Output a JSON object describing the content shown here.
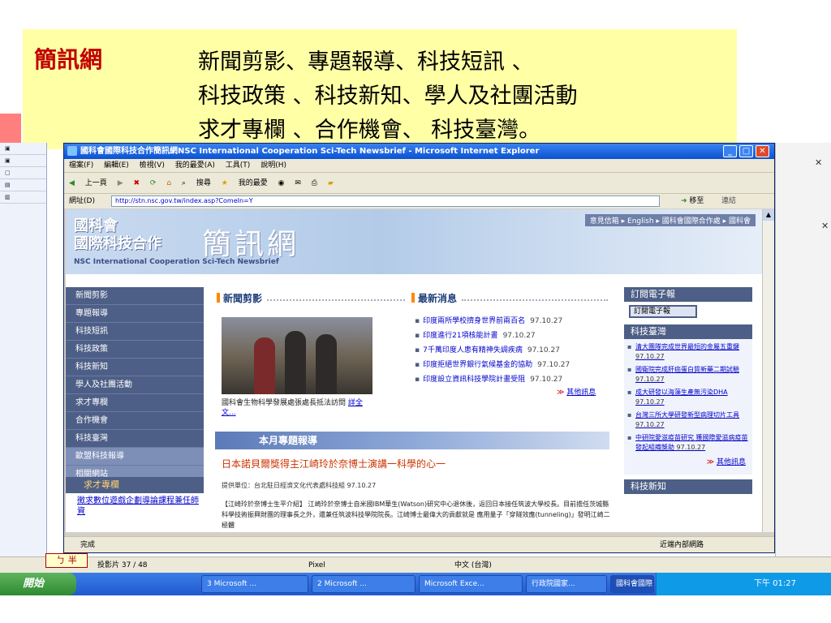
{
  "slide": {
    "brand": "簡訊網",
    "line1": "新聞剪影、專題報導、科技短訊 、",
    "line2": "科技政策 、科技新知、學人及社團活動",
    "line3": "求才專欄 、合作機會、 科技臺灣。"
  },
  "ie": {
    "title": "國科會國際科技合作簡訊網NSC International Cooperation Sci-Tech Newsbrief - Microsoft Internet Explorer",
    "menu": [
      "檔案(F)",
      "編輯(E)",
      "檢視(V)",
      "我的最愛(A)",
      "工具(T)",
      "說明(H)"
    ],
    "toolbar": {
      "back": "上一頁",
      "search": "搜尋",
      "favorites": "我的最愛"
    },
    "address_label": "網址(D)",
    "address_url": "http://stn.nsc.gov.tw/index.asp?ComeIn=Y",
    "go": "移至",
    "links": "連結",
    "status": "完成",
    "zone": "近端內部網路"
  },
  "site": {
    "top_links": "意見信箱 ▸ English ▸ 國科會國際合作處 ▸ 國科會",
    "cn_line1": "國科會",
    "cn_line2": "國際科技合作",
    "logo": "簡訊網",
    "en_name": "NSC International Cooperation Sci-Tech Newsbrief",
    "nav": [
      "新聞剪影",
      "專題報導",
      "科技短訊",
      "科技政策",
      "科技新知",
      "學人及社團活動",
      "求才專欄",
      "合作機會",
      "科技臺灣",
      "歐盟科技報導",
      "相關網站"
    ],
    "job_head": "求才專欄",
    "job_link": "徵求數位遊戲企劃導論課程兼任師資",
    "photo_section": "新聞剪影",
    "photo_caption": "國科會生物科學發展處張處長抵法訪問",
    "photo_more": "詳全文...",
    "news_section": "最新消息",
    "news": [
      {
        "title": "印度兩所學校擠身世界前兩百名",
        "date": "97.10.27"
      },
      {
        "title": "印度進行21項核能計畫",
        "date": "97.10.27"
      },
      {
        "title": "7千萬印度人患有精神失調疾病",
        "date": "97.10.27"
      },
      {
        "title": "印度拒絕世界銀行氣候基金的協助",
        "date": "97.10.27"
      },
      {
        "title": "印度設立資訊科技學院計畫受阻",
        "date": "97.10.27"
      }
    ],
    "news_more": "其他訊息",
    "feature_bar": "本月專題報導",
    "feature_title": "日本諾貝爾獎得主江崎玲於奈博士演講一科學的心一",
    "feature_source": "提供單位：台北駐日經濟文化代表處科技組 97.10.27",
    "feature_text": "【江崎玲於奈博士生平介紹】 江崎玲於奈博士自米國IBM華生(Watson)研究中心退休後，返回日本接任筑波大學校長。目前擔任茨城縣科學技術振興財團的理事長之外，還兼任筑波科技學院院長。江崎博士最偉大的貢獻就是 應用量子「穿隧效應(tunneling)」發明江崎二極體",
    "subscribe_head": "訂閱電子報",
    "subscribe_btn": "訂閱電子報",
    "taiwan_head": "科技臺灣",
    "taiwan": [
      {
        "title": "清大團隊完成世界最短的金屬五重鍵",
        "date": "97.10.27"
      },
      {
        "title": "國衛院完成肝癌蛋白質新藥二期試驗",
        "date": "97.10.27"
      },
      {
        "title": "成大研發以海藻生產無污染DHA",
        "date": "97.10.27"
      },
      {
        "title": "台灣三所大學研發新型病理切片工具",
        "date": "97.10.27"
      },
      {
        "title": "中研院愛滋疫苗研究 獲國際愛滋病疫苗發起組織獎助",
        "date": "97.10.27"
      }
    ],
    "taiwan_more": "其他訊息",
    "sci_head": "科技新知"
  },
  "ppt_status": {
    "slide": "投影片 37 / 48",
    "design": "Pixel",
    "lang": "中文 (台灣)",
    "ime": "ㄅ 半"
  },
  "taskbar": {
    "start": "開始",
    "tasks": [
      "3 Microsoft ...",
      "2 Microsoft ...",
      "Microsoft Exce...",
      "行政院國家...",
      "國科會國際..."
    ],
    "time": "下午 01:27"
  },
  "colors": {
    "slide_bg": "#ffffa6",
    "brand_red": "#c00000",
    "nav_bg": "#4d5f86",
    "accent_orange": "#ff8800"
  }
}
